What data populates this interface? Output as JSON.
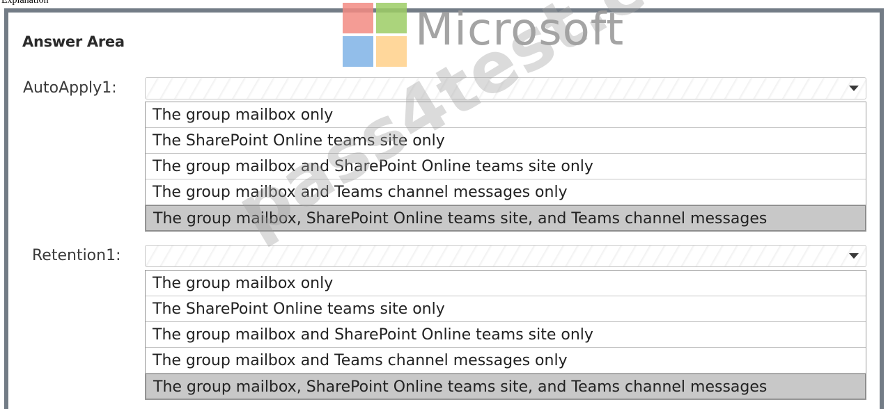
{
  "caption": "Explanation",
  "logo": {
    "text": "Microsoft"
  },
  "watermark": "pass4test.com",
  "answer_area": {
    "title": "Answer Area",
    "fields": [
      {
        "label": "AutoApply1:",
        "selected_value": "",
        "options": [
          "The group mailbox only",
          "The SharePoint Online teams site only",
          "The group mailbox and SharePoint Online teams site only",
          "The group mailbox and Teams channel messages only",
          "The group mailbox, SharePoint Online teams site, and Teams channel messages"
        ],
        "selected_option": "The group mailbox, SharePoint Online teams site, and Teams channel messages"
      },
      {
        "label": "Retention1:",
        "selected_value": "",
        "options": [
          "The group mailbox only",
          "The SharePoint Online teams site only",
          "The group mailbox and SharePoint Online teams site only",
          "The group mailbox and Teams channel messages only",
          "The group mailbox, SharePoint Online teams site, and Teams channel messages"
        ],
        "selected_option": "The group mailbox, SharePoint Online teams site, and Teams channel messages"
      }
    ]
  },
  "icons": {
    "dropdown": "chevron-down-icon",
    "logo": "microsoft-logo-icon"
  },
  "colors": {
    "frame": "#737c86",
    "selected_option": "#c8c8c8"
  }
}
